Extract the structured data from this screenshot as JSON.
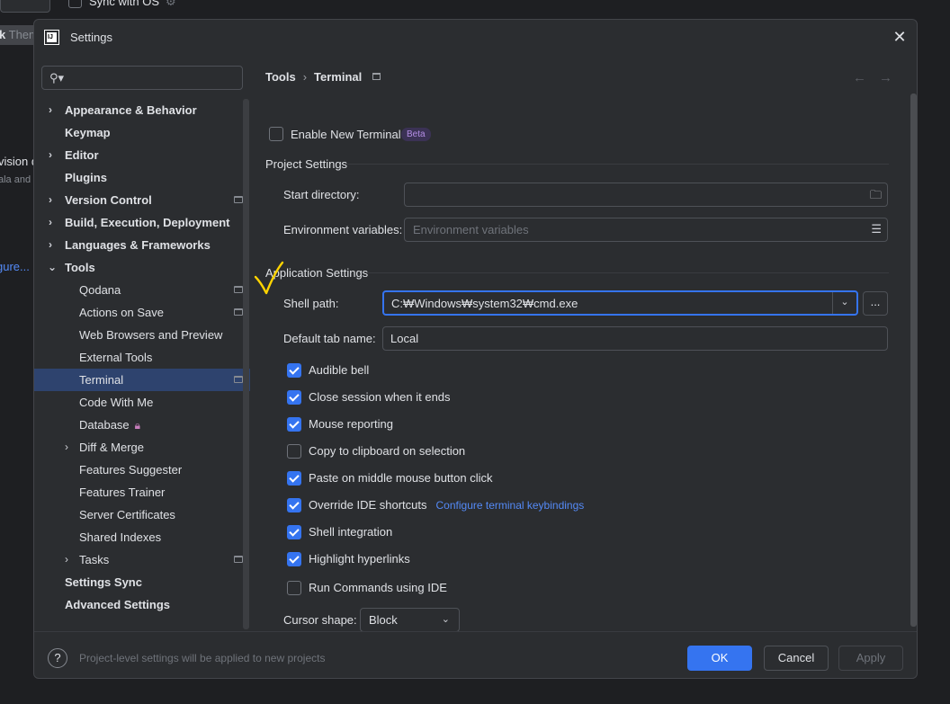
{
  "background": {
    "sync_label": "Sync with OS",
    "theme_text": "k",
    "theme_hint": "Them",
    "side_text_1": "vision d",
    "side_text_2": "ala and",
    "side_link": "gure..."
  },
  "dialog": {
    "title": "Settings",
    "app_icon": "IJ"
  },
  "search": {
    "placeholder": ""
  },
  "sidebar": {
    "items": [
      {
        "label": "Appearance & Behavior"
      },
      {
        "label": "Keymap"
      },
      {
        "label": "Editor"
      },
      {
        "label": "Plugins"
      },
      {
        "label": "Version Control"
      },
      {
        "label": "Build, Execution, Deployment"
      },
      {
        "label": "Languages & Frameworks"
      },
      {
        "label": "Tools"
      },
      {
        "label": "Qodana"
      },
      {
        "label": "Actions on Save"
      },
      {
        "label": "Web Browsers and Preview"
      },
      {
        "label": "External Tools"
      },
      {
        "label": "Terminal"
      },
      {
        "label": "Code With Me"
      },
      {
        "label": "Database"
      },
      {
        "label": "Diff & Merge"
      },
      {
        "label": "Features Suggester"
      },
      {
        "label": "Features Trainer"
      },
      {
        "label": "Server Certificates"
      },
      {
        "label": "Shared Indexes"
      },
      {
        "label": "Tasks"
      },
      {
        "label": "Settings Sync"
      },
      {
        "label": "Advanced Settings"
      }
    ]
  },
  "breadcrumb": {
    "parent": "Tools",
    "current": "Terminal"
  },
  "terminal": {
    "enable_new_terminal": "Enable New Terminal",
    "beta_badge": "Beta",
    "project_settings": "Project Settings",
    "start_directory_label": "Start directory:",
    "start_directory_value": "",
    "env_vars_label": "Environment variables:",
    "env_vars_placeholder": "Environment variables",
    "application_settings": "Application Settings",
    "shell_path_label": "Shell path:",
    "shell_path_value": "C:₩Windows₩system32₩cmd.exe",
    "browse_label": "...",
    "default_tab_label": "Default tab name:",
    "default_tab_value": "Local",
    "options": [
      {
        "label": "Audible bell",
        "checked": true
      },
      {
        "label": "Close session when it ends",
        "checked": true
      },
      {
        "label": "Mouse reporting",
        "checked": true
      },
      {
        "label": "Copy to clipboard on selection",
        "checked": false
      },
      {
        "label": "Paste on middle mouse button click",
        "checked": true
      },
      {
        "label": "Override IDE shortcuts",
        "checked": true
      },
      {
        "label": "Shell integration",
        "checked": true
      },
      {
        "label": "Highlight hyperlinks",
        "checked": true
      },
      {
        "label": "Run Commands using IDE",
        "checked": false
      }
    ],
    "configure_link": "Configure terminal keybindings",
    "cursor_shape_label": "Cursor shape:",
    "cursor_shape_value": "Block"
  },
  "footer": {
    "help": "?",
    "note": "Project-level settings will be applied to new projects",
    "ok": "OK",
    "cancel": "Cancel",
    "apply": "Apply"
  },
  "colors": {
    "accent": "#3574f0",
    "background": "#2b2d30",
    "selection": "#2e436e",
    "annotation": "#ffd400",
    "link": "#548af7"
  },
  "icons": [
    "search-icon",
    "close-icon",
    "chevron-right-icon",
    "chevron-down-icon",
    "folder-icon",
    "list-icon",
    "lock-icon",
    "help-icon",
    "back-arrow-icon",
    "forward-arrow-icon"
  ]
}
